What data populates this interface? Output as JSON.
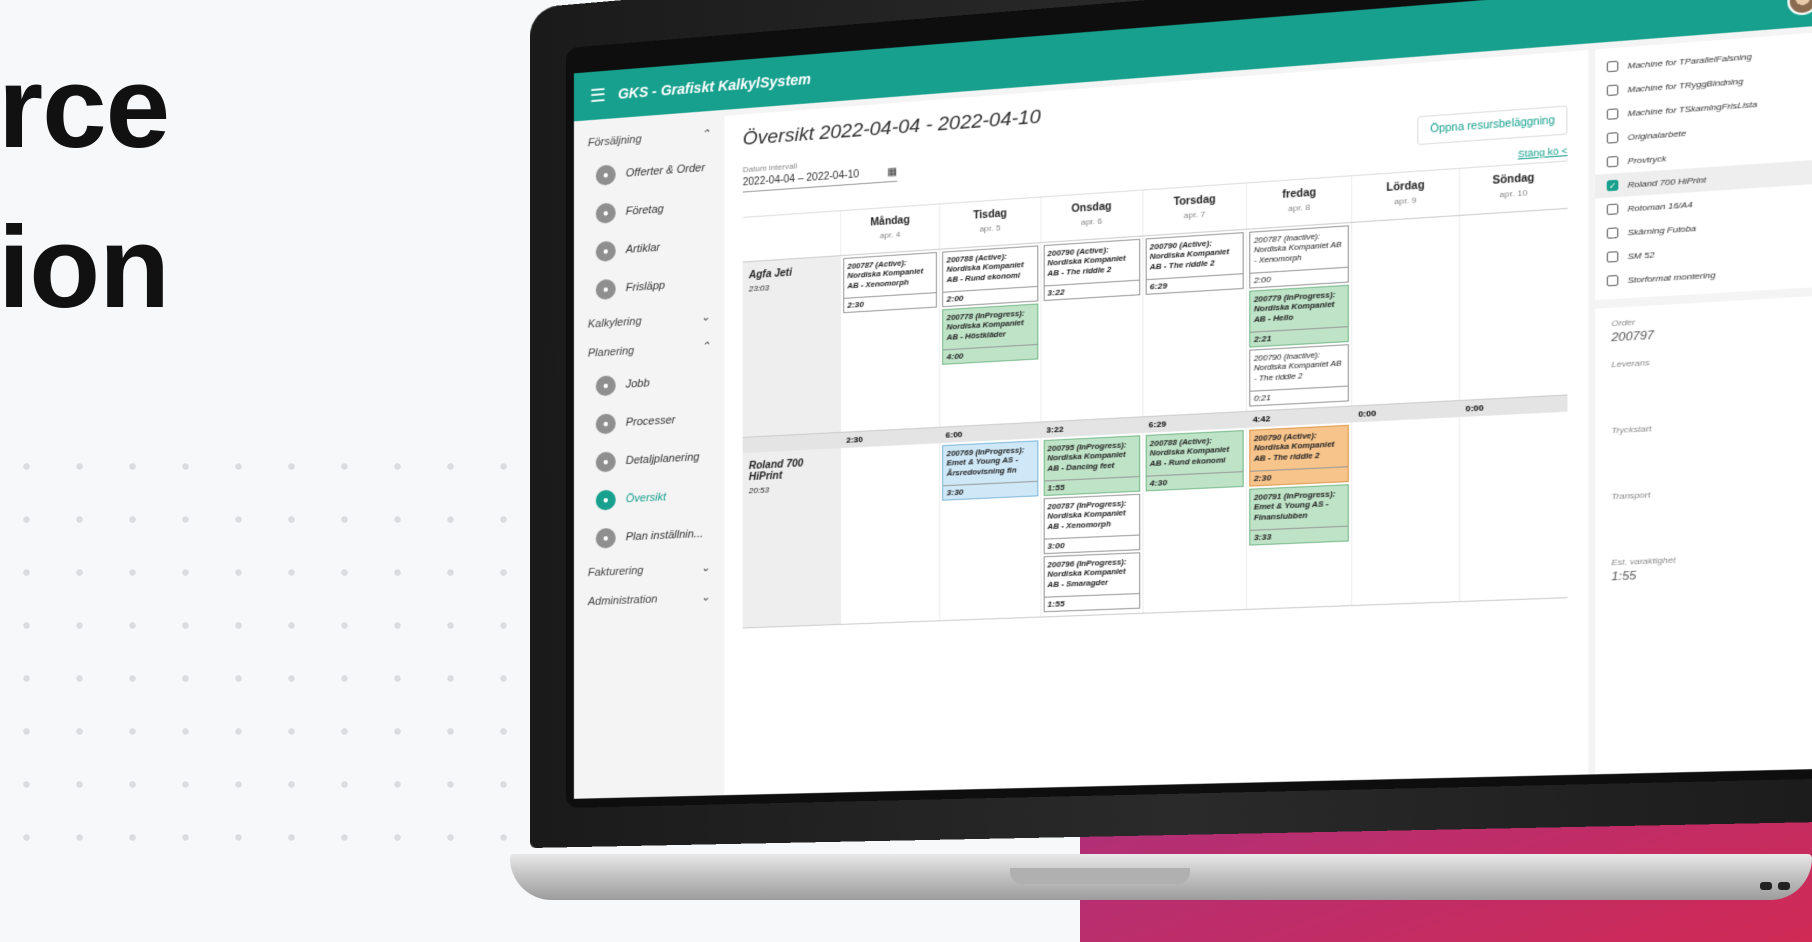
{
  "hero": {
    "line1": "rce",
    "line2": "ion"
  },
  "app": {
    "title": "GKS - Grafiskt KalkylSystem",
    "sidebar": {
      "groups": [
        {
          "label": "Försäljning",
          "expanded": true
        },
        {
          "label": "Kalkylering",
          "expanded": false
        },
        {
          "label": "Planering",
          "expanded": true
        },
        {
          "label": "Fakturering",
          "expanded": false
        },
        {
          "label": "Administration",
          "expanded": false
        }
      ],
      "sales_items": [
        "Offerter & Order",
        "Företag",
        "Artiklar",
        "Frisläpp"
      ],
      "planning_items": [
        "Jobb",
        "Processer",
        "Detaljplanering",
        "Översikt",
        "Plan inställnin..."
      ]
    },
    "main": {
      "title": "Översikt 2022-04-04 - 2022-04-10",
      "date_label": "Datum intervall",
      "date_value": "2022-04-04 – 2022-04-10",
      "open_button": "Öppna resursbeläggning",
      "close_queue": "Stäng kö <",
      "days": [
        {
          "name": "Måndag",
          "date": "apr. 4"
        },
        {
          "name": "Tisdag",
          "date": "apr. 5"
        },
        {
          "name": "Onsdag",
          "date": "apr. 6"
        },
        {
          "name": "Torsdag",
          "date": "apr. 7"
        },
        {
          "name": "fredag",
          "date": "apr. 8"
        },
        {
          "name": "Lördag",
          "date": "apr. 9"
        },
        {
          "name": "Söndag",
          "date": "apr. 10"
        }
      ],
      "lanes": [
        {
          "name": "Agfa Jeti",
          "total": "23:03",
          "sums": [
            "2:30",
            "6:00",
            "3:22",
            "6:29",
            "4:42",
            "0:00",
            "0:00"
          ],
          "columns": [
            [
              {
                "text": "200787 (Active): Nordiska Kompaniet AB - Xenomorph",
                "dur": "2:30",
                "color": "white"
              }
            ],
            [
              {
                "text": "200788 (Active): Nordiska Kompaniet AB - Rund ekonomi",
                "dur": "2:00",
                "color": "white"
              },
              {
                "text": "200778 (InProgress): Nordiska Kompaniet AB - Höstkläder",
                "dur": "4:00",
                "color": "green"
              }
            ],
            [
              {
                "text": "200790 (Active): Nordiska Kompaniet AB - The riddle 2",
                "dur": "3:22",
                "color": "white"
              }
            ],
            [
              {
                "text": "200790 (Active): Nordiska Kompaniet AB - The riddle 2",
                "dur": "6:29",
                "color": "white"
              }
            ],
            [
              {
                "text": "200787 (Inactive): Nordiska Kompaniet AB - Xenomorph",
                "dur": "2:00",
                "color": "inactive"
              },
              {
                "text": "200779 (InProgress): Nordiska Kompaniet AB - Hello",
                "dur": "2:21",
                "color": "green"
              },
              {
                "text": "200790 (Inactive): Nordiska Kompaniet AB - The riddle 2",
                "dur": "0:21",
                "color": "inactive"
              }
            ],
            [],
            []
          ]
        },
        {
          "name": "Roland 700 HiPrint",
          "total": "20:53",
          "columns": [
            [],
            [
              {
                "text": "200769 (InProgress): Emet & Young AS - Årsredovisning fin",
                "dur": "3:30",
                "color": "blue"
              }
            ],
            [
              {
                "text": "200795 (InProgress): Nordiska Kompaniet AB - Dancing feet",
                "dur": "1:55",
                "color": "green"
              },
              {
                "text": "200787 (InProgress): Nordiska Kompaniet AB - Xenomorph",
                "dur": "3:00",
                "color": "white"
              },
              {
                "text": "200796 (InProgress): Nordiska Kompaniet AB - Smaragder",
                "dur": "1:55",
                "color": "white"
              }
            ],
            [
              {
                "text": "200788 (Active): Nordiska Kompaniet AB - Rund ekonomi",
                "dur": "4:30",
                "color": "green"
              }
            ],
            [
              {
                "text": "200790 (Active): Nordiska Kompaniet AB - The riddle 2",
                "dur": "2:30",
                "color": "orange"
              },
              {
                "text": "200791 (InProgress): Emet & Young AS - Finanslubben",
                "dur": "3:33",
                "color": "green"
              }
            ],
            [],
            []
          ]
        }
      ]
    },
    "resources": [
      {
        "label": "Machine for TParallelFalsning",
        "checked": false
      },
      {
        "label": "Machine for TRyggBindning",
        "checked": false
      },
      {
        "label": "Machine for TSkarningFrisLista",
        "checked": false
      },
      {
        "label": "Originalarbete",
        "checked": false
      },
      {
        "label": "Provtryck",
        "checked": false
      },
      {
        "label": "Roland 700 HiPrint",
        "checked": true
      },
      {
        "label": "Rotoman 16/A4",
        "checked": false
      },
      {
        "label": "Skärning Futoba",
        "checked": false
      },
      {
        "label": "SM 52",
        "checked": false
      },
      {
        "label": "Storformat montering",
        "checked": false
      }
    ],
    "order_card": {
      "order_label": "Order",
      "order_value": "200797",
      "leverans_label": "Leverans",
      "tryckstart_label": "Tryckstart",
      "transport_label": "Transport",
      "est_label": "Est. varaktighet",
      "est_value": "1:55"
    },
    "colors": {
      "accent": "#17a08d",
      "green": "#bfe3c7",
      "blue": "#cfe8f7",
      "orange": "#f7c48c"
    }
  }
}
